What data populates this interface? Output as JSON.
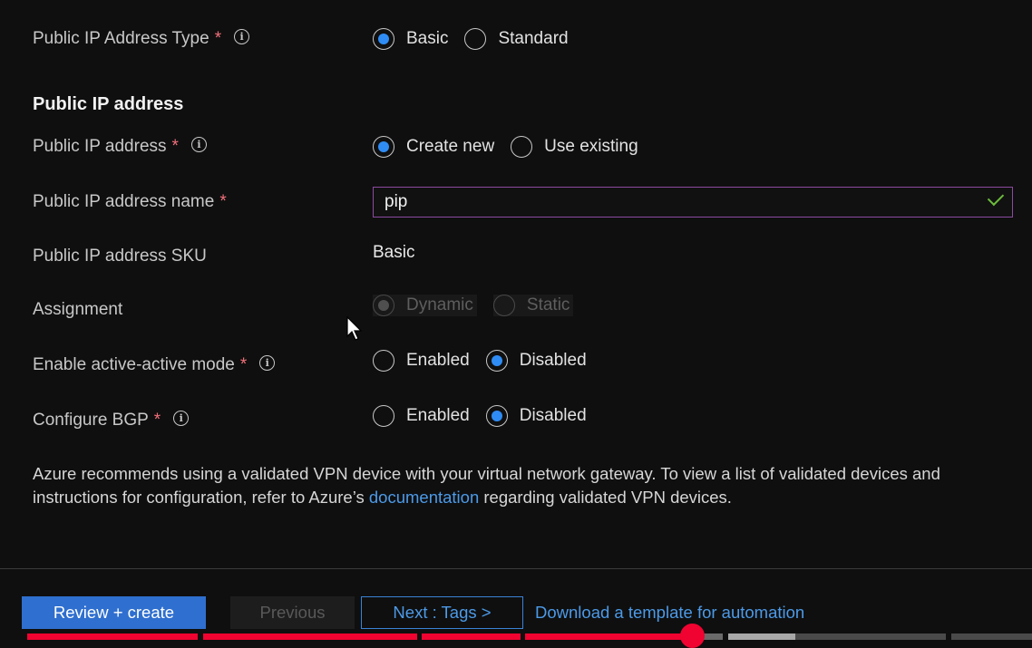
{
  "form": {
    "ip_type": {
      "label": "Public IP Address Type",
      "required": "*",
      "options": [
        "Basic",
        "Standard"
      ],
      "selected": "Basic"
    },
    "section_title": "Public IP address",
    "ip_address": {
      "label": "Public IP address",
      "required": "*",
      "options": [
        "Create new",
        "Use existing"
      ],
      "selected": "Create new"
    },
    "ip_name": {
      "label": "Public IP address name",
      "required": "*",
      "value": "pip"
    },
    "ip_sku": {
      "label": "Public IP address SKU",
      "value": "Basic"
    },
    "assignment": {
      "label": "Assignment",
      "options": [
        "Dynamic",
        "Static"
      ],
      "selected": "Dynamic",
      "disabled": true
    },
    "active_active": {
      "label": "Enable active-active mode",
      "required": "*",
      "options": [
        "Enabled",
        "Disabled"
      ],
      "selected": "Disabled"
    },
    "bgp": {
      "label": "Configure BGP",
      "required": "*",
      "options": [
        "Enabled",
        "Disabled"
      ],
      "selected": "Disabled"
    }
  },
  "notice": {
    "text_before": "Azure recommends using a validated VPN device with your virtual network gateway. To view a list of validated devices and instructions for configuration, refer to Azure’s ",
    "link": "documentation",
    "text_after": " regarding validated VPN devices."
  },
  "footer": {
    "review_create": "Review + create",
    "previous": "Previous",
    "next": "Next : Tags >",
    "download": "Download a template for automation"
  },
  "icons": {
    "info": "info-icon",
    "check": "checkmark-icon",
    "cursor": "mouse-pointer-icon"
  },
  "colors": {
    "accent": "#2f8cf4",
    "required": "#f1707b",
    "link": "#4c9ae8",
    "valid": "#6cbb3c",
    "progress": "#f00330"
  },
  "video_progress": {
    "played_fraction": 0.67
  }
}
